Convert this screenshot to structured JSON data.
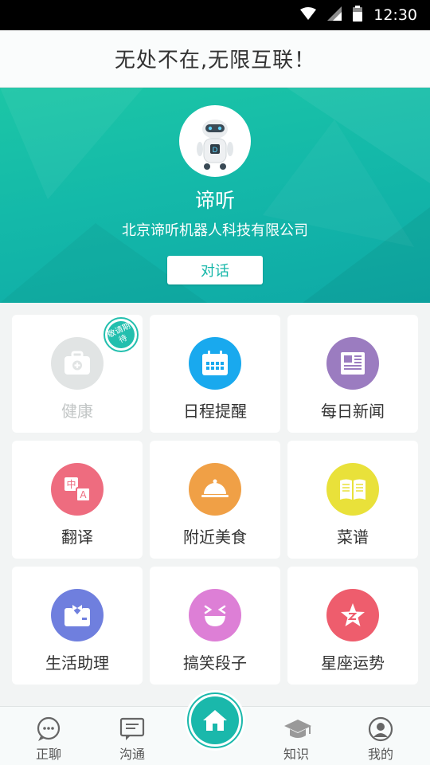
{
  "status_bar": {
    "time": "12:30"
  },
  "header": {
    "title": "无处不在,无限互联！"
  },
  "hero": {
    "bot_name": "谛听",
    "company": "北京谛听机器人科技有限公司",
    "talk_button": "对话"
  },
  "colors": {
    "accent": "#17b7a9",
    "health": "#e1e4e4",
    "schedule": "#19a9ee",
    "news": "#9b7cc0",
    "translate": "#ee6c7f",
    "food": "#f0a046",
    "recipe": "#e9e13a",
    "assistant": "#6f7fde",
    "jokes": "#dd7fd6",
    "horoscope": "#ee5d6d"
  },
  "services": [
    {
      "label": "健康",
      "icon": "medical-kit-icon",
      "badge": "敬请期待",
      "enabled": false
    },
    {
      "label": "日程提醒",
      "icon": "calendar-icon",
      "enabled": true
    },
    {
      "label": "每日新闻",
      "icon": "newspaper-icon",
      "enabled": true
    },
    {
      "label": "翻译",
      "icon": "translate-icon",
      "badge_text": [
        "中",
        "A"
      ],
      "enabled": true
    },
    {
      "label": "附近美食",
      "icon": "food-cloche-icon",
      "enabled": true
    },
    {
      "label": "菜谱",
      "icon": "open-book-icon",
      "enabled": true
    },
    {
      "label": "生活助理",
      "icon": "butler-icon",
      "enabled": true
    },
    {
      "label": "搞笑段子",
      "icon": "laughing-face-icon",
      "enabled": true
    },
    {
      "label": "星座运势",
      "icon": "star-icon",
      "enabled": true
    }
  ],
  "tabbar": {
    "items": [
      {
        "label": "正聊",
        "icon": "chat-bubble-icon"
      },
      {
        "label": "沟通",
        "icon": "message-icon"
      },
      {
        "label": "",
        "icon": "home-icon"
      },
      {
        "label": "知识",
        "icon": "graduation-cap-icon"
      },
      {
        "label": "我的",
        "icon": "user-icon"
      }
    ]
  }
}
